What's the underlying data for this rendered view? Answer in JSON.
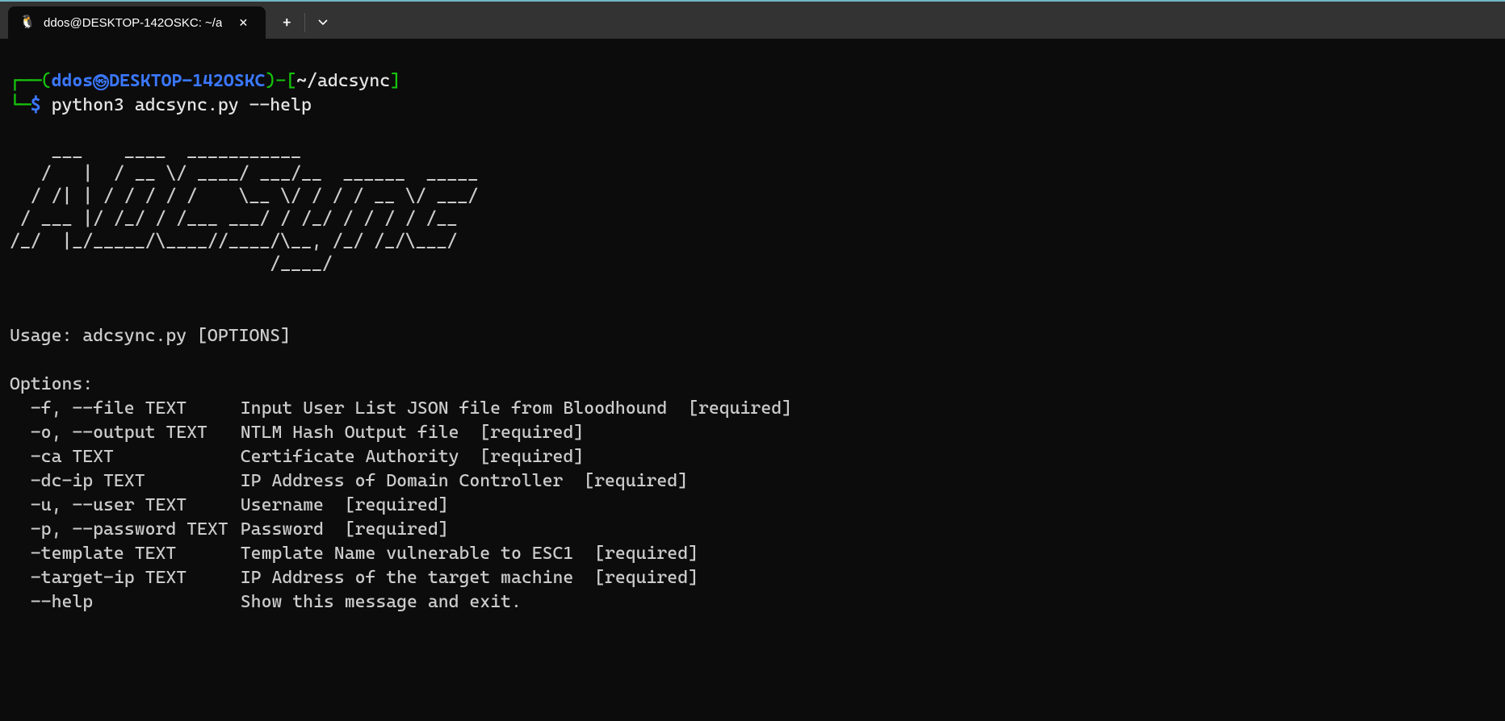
{
  "tab": {
    "title": "ddos@DESKTOP-142OSKC: ~/a"
  },
  "prompt": {
    "open_paren": "(",
    "user": "ddos",
    "host": "DESKTOP-142OSKC",
    "close_paren": ")",
    "dash": "-",
    "lbracket": "[",
    "path": "~/adcsync",
    "rbracket": "]",
    "symbol": "$",
    "command": "python3 adcsync.py --help"
  },
  "ascii": [
    "    ___    ____  ___________                 ",
    "   /   |  / __ \\/ ____/ ___/__  ______  _____",
    "  / /| | / / / / /    \\__ \\/ / / / __ \\/ ___/",
    " / ___ |/ /_/ / /___ ___/ / /_/ / / / / /__  ",
    "/_/  |_/_____/\\____//____/\\__, /_/ /_/\\___/  ",
    "                         /____/              "
  ],
  "usage": "Usage: adcsync.py [OPTIONS]",
  "options_header": "Options:",
  "options": [
    {
      "flag": "-f, --file TEXT",
      "desc": "Input User List JSON file from Bloodhound  [required]"
    },
    {
      "flag": "-o, --output TEXT",
      "desc": "NTLM Hash Output file  [required]"
    },
    {
      "flag": "-ca TEXT",
      "desc": "Certificate Authority  [required]"
    },
    {
      "flag": "-dc-ip TEXT",
      "desc": "IP Address of Domain Controller  [required]"
    },
    {
      "flag": "-u, --user TEXT",
      "desc": "Username  [required]"
    },
    {
      "flag": "-p, --password TEXT",
      "desc": "Password  [required]"
    },
    {
      "flag": "-template TEXT",
      "desc": "Template Name vulnerable to ESC1  [required]"
    },
    {
      "flag": "-target-ip TEXT",
      "desc": "IP Address of the target machine  [required]"
    },
    {
      "flag": "--help",
      "desc": "Show this message and exit."
    }
  ]
}
